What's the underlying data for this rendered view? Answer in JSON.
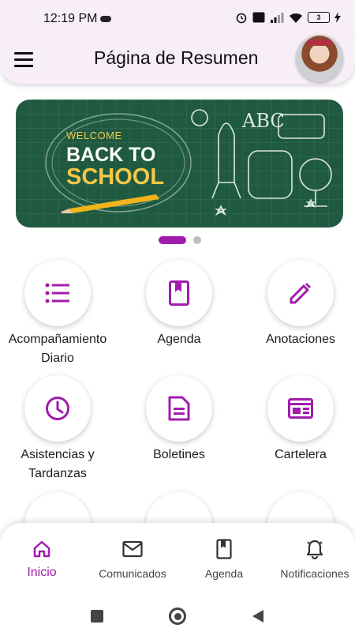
{
  "status": {
    "time": "12:19 PM",
    "battery": "3"
  },
  "appbar": {
    "title": "Página de Resumen"
  },
  "banner": {
    "welcome": "WELCOME",
    "line1": "BACK TO",
    "line2": "SCHOOL"
  },
  "grid": [
    {
      "label": "Acompañamiento Diario",
      "icon": "list-icon"
    },
    {
      "label": "Agenda",
      "icon": "bookmark-book-icon"
    },
    {
      "label": "Anotaciones",
      "icon": "pencil-icon"
    },
    {
      "label": "Asistencias y Tardanzas",
      "icon": "clock-icon"
    },
    {
      "label": "Boletines",
      "icon": "document-icon"
    },
    {
      "label": "Cartelera",
      "icon": "board-icon"
    }
  ],
  "bottom_nav": [
    {
      "label": "Inicio",
      "icon": "home-icon",
      "active": true
    },
    {
      "label": "Comunicados",
      "icon": "mail-icon"
    },
    {
      "label": "Agenda",
      "icon": "bookmark-book-icon"
    },
    {
      "label": "Notificaciones",
      "icon": "bell-icon"
    }
  ],
  "colors": {
    "accent": "#a11cad",
    "header_bg": "#f8eef8",
    "banner_bg": "#1f5a40"
  }
}
